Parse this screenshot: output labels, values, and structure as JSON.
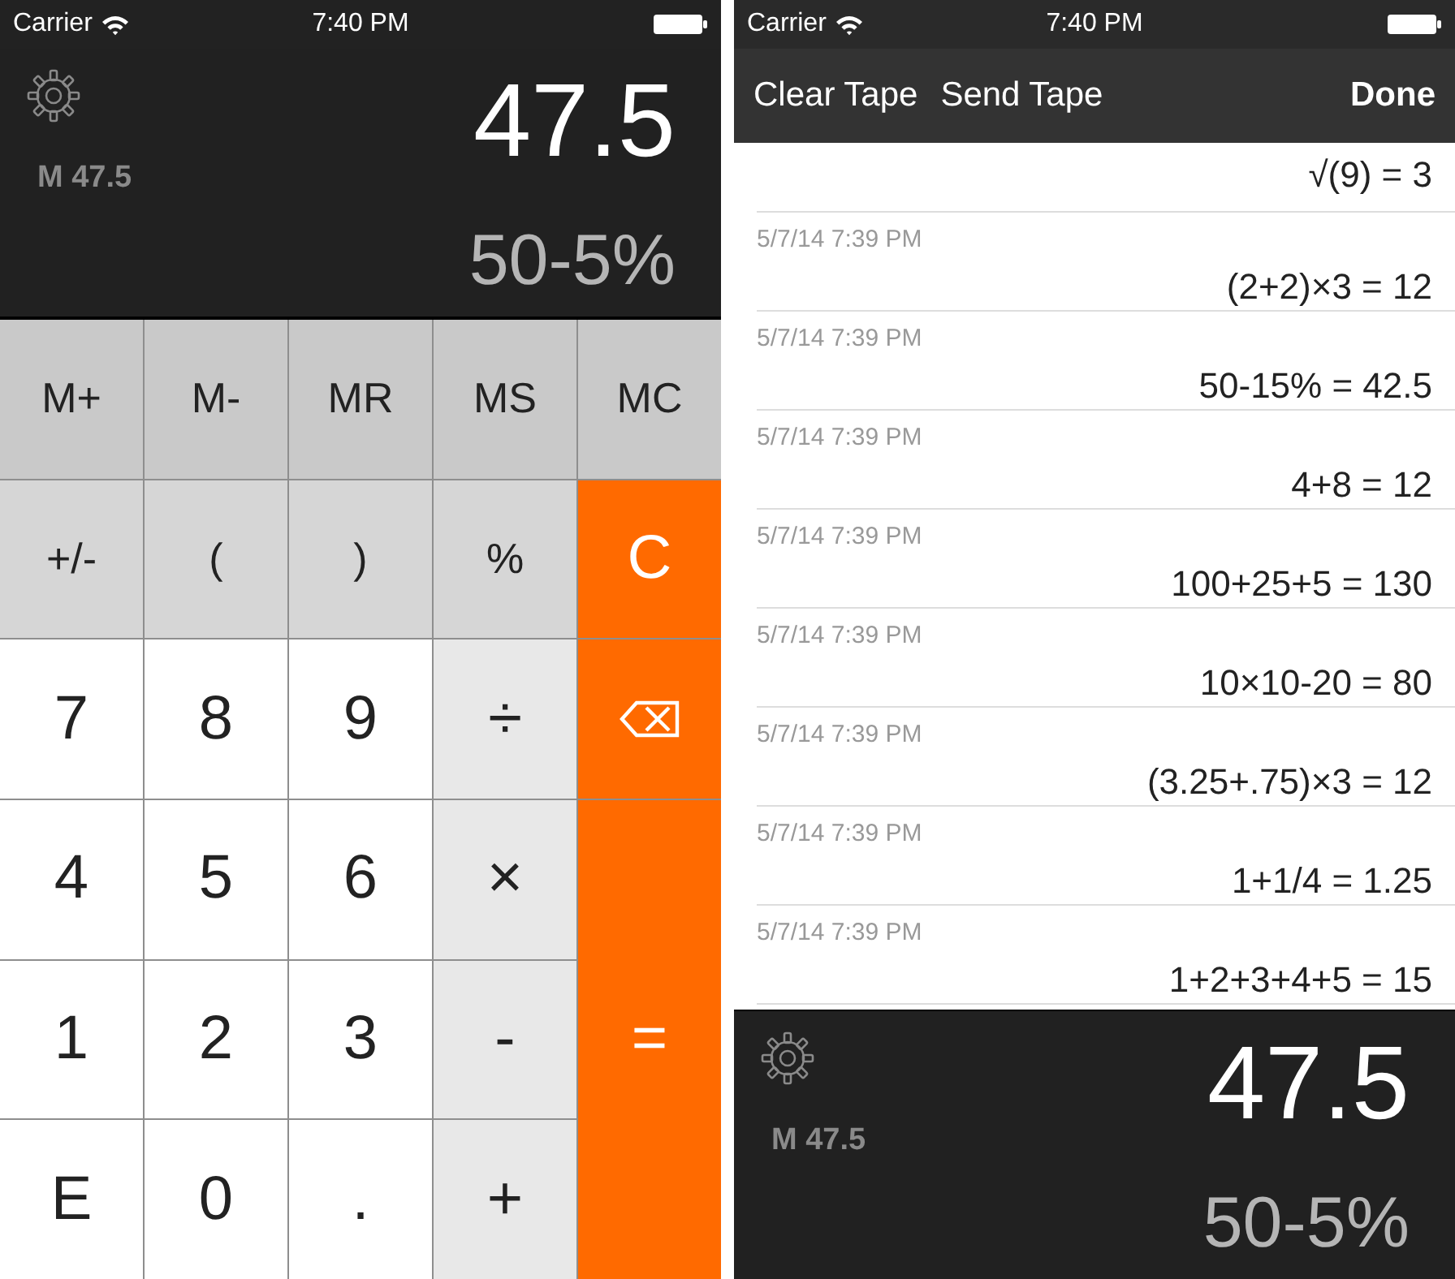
{
  "left_screen": {
    "status_bar": {
      "carrier": "Carrier",
      "time": "7:40 PM"
    },
    "display": {
      "memory": "M 47.5",
      "result": "47.5",
      "expression": "50-5%"
    },
    "keypad": [
      {
        "label": "M+",
        "kind": "memory"
      },
      {
        "label": "M-",
        "kind": "memory"
      },
      {
        "label": "MR",
        "kind": "memory"
      },
      {
        "label": "MS",
        "kind": "memory"
      },
      {
        "label": "MC",
        "kind": "memory"
      },
      {
        "label": "+/-",
        "kind": "function"
      },
      {
        "label": "(",
        "kind": "function"
      },
      {
        "label": ")",
        "kind": "function"
      },
      {
        "label": "%",
        "kind": "function"
      },
      {
        "label": "C",
        "kind": "clear"
      },
      {
        "label": "7",
        "kind": "digit"
      },
      {
        "label": "8",
        "kind": "digit"
      },
      {
        "label": "9",
        "kind": "digit"
      },
      {
        "label": "÷",
        "kind": "operator"
      },
      {
        "kind": "backspace"
      },
      {
        "label": "4",
        "kind": "digit"
      },
      {
        "label": "5",
        "kind": "digit"
      },
      {
        "label": "6",
        "kind": "digit"
      },
      {
        "label": "×",
        "kind": "operator"
      },
      {
        "label": "1",
        "kind": "digit"
      },
      {
        "label": "2",
        "kind": "digit"
      },
      {
        "label": "3",
        "kind": "digit"
      },
      {
        "label": "-",
        "kind": "operator"
      },
      {
        "label": "=",
        "kind": "equals"
      },
      {
        "label": "E",
        "kind": "digit"
      },
      {
        "label": "0",
        "kind": "digit"
      },
      {
        "label": ".",
        "kind": "digit"
      },
      {
        "label": "+",
        "kind": "operator"
      }
    ]
  },
  "right_screen": {
    "status_bar": {
      "carrier": "Carrier",
      "time": "7:40 PM"
    },
    "toolbar": {
      "buttons": [
        "Clear Tape",
        "Send Tape"
      ],
      "done": "Done"
    },
    "tape": [
      {
        "expression": "√(9) = 3"
      },
      {
        "time": "5/7/14 7:39 PM",
        "expression": "(2+2)×3 = 12"
      },
      {
        "time": "5/7/14 7:39 PM",
        "expression": "50-15% = 42.5"
      },
      {
        "time": "5/7/14 7:39 PM",
        "expression": "4+8 = 12"
      },
      {
        "time": "5/7/14 7:39 PM",
        "expression": "100+25+5 = 130"
      },
      {
        "time": "5/7/14 7:39 PM",
        "expression": "10×10-20 = 80"
      },
      {
        "time": "5/7/14 7:39 PM",
        "expression": "(3.25+.75)×3 = 12"
      },
      {
        "time": "5/7/14 7:39 PM",
        "expression": "1+1/4 = 1.25"
      },
      {
        "time": "5/7/14 7:39 PM",
        "expression": "1+2+3+4+5 = 15"
      }
    ],
    "display": {
      "memory": "M 47.5",
      "result": "47.5",
      "expression": "50-5%"
    }
  }
}
